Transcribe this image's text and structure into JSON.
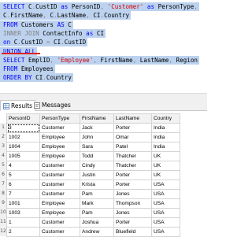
{
  "editor": {
    "lines": [
      {
        "parts": [
          {
            "t": "SELECT ",
            "c": "kw"
          },
          {
            "t": "C",
            "c": "id"
          },
          {
            "t": ".",
            "c": "gray"
          },
          {
            "t": "CustID ",
            "c": "id"
          },
          {
            "t": "as ",
            "c": "kw"
          },
          {
            "t": "PersonID",
            "c": "id"
          },
          {
            "t": ", ",
            "c": "gray"
          },
          {
            "t": "'Customer'",
            "c": "str"
          },
          {
            "t": " as ",
            "c": "kw"
          },
          {
            "t": "PersonType",
            "c": "id"
          },
          {
            "t": ",",
            "c": "gray"
          }
        ]
      },
      {
        "parts": [
          {
            "t": "C",
            "c": "id"
          },
          {
            "t": ".",
            "c": "gray"
          },
          {
            "t": "FirstName",
            "c": "id"
          },
          {
            "t": ", ",
            "c": "gray"
          },
          {
            "t": "C",
            "c": "id"
          },
          {
            "t": ".",
            "c": "gray"
          },
          {
            "t": "LastName",
            "c": "id"
          },
          {
            "t": ", ",
            "c": "gray"
          },
          {
            "t": "CI",
            "c": "id"
          },
          {
            "t": ".",
            "c": "gray"
          },
          {
            "t": "Country",
            "c": "id"
          }
        ]
      },
      {
        "parts": [
          {
            "t": "FROM ",
            "c": "kw"
          },
          {
            "t": "Customers ",
            "c": "id"
          },
          {
            "t": "AS ",
            "c": "kw"
          },
          {
            "t": "C",
            "c": "id"
          }
        ]
      },
      {
        "parts": [
          {
            "t": "INNER JOIN ",
            "c": "gray"
          },
          {
            "t": "ContactInfo ",
            "c": "id"
          },
          {
            "t": "as ",
            "c": "kw"
          },
          {
            "t": "CI",
            "c": "id"
          }
        ]
      },
      {
        "parts": [
          {
            "t": "on ",
            "c": "kw"
          },
          {
            "t": "C",
            "c": "id"
          },
          {
            "t": ".",
            "c": "gray"
          },
          {
            "t": "CustID ",
            "c": "id"
          },
          {
            "t": "= ",
            "c": "gray"
          },
          {
            "t": "CI",
            "c": "id"
          },
          {
            "t": ".",
            "c": "gray"
          },
          {
            "t": "CustID",
            "c": "id"
          }
        ]
      },
      {
        "parts": [
          {
            "t": "UNION ALL",
            "c": "kw"
          }
        ]
      },
      {
        "parts": [
          {
            "t": "SELECT ",
            "c": "kw"
          },
          {
            "t": "EmplID",
            "c": "id"
          },
          {
            "t": ", ",
            "c": "gray"
          },
          {
            "t": "'Employee'",
            "c": "str"
          },
          {
            "t": ", ",
            "c": "gray"
          },
          {
            "t": "FirstName",
            "c": "id"
          },
          {
            "t": ", ",
            "c": "gray"
          },
          {
            "t": "LastName",
            "c": "id"
          },
          {
            "t": ", ",
            "c": "gray"
          },
          {
            "t": "Region",
            "c": "id"
          }
        ]
      },
      {
        "parts": [
          {
            "t": "FROM ",
            "c": "kw"
          },
          {
            "t": "Employees",
            "c": "id"
          }
        ]
      },
      {
        "parts": [
          {
            "t": "ORDER BY ",
            "c": "kw"
          },
          {
            "t": "CI",
            "c": "id"
          },
          {
            "t": ".",
            "c": "gray"
          },
          {
            "t": "Country",
            "c": "id"
          }
        ]
      }
    ]
  },
  "tabs": {
    "results": "Results",
    "messages": "Messages"
  },
  "results": {
    "columns": [
      "PersonID",
      "PersonType",
      "FirstName",
      "LastName",
      "Country"
    ],
    "rows": [
      [
        "3",
        "Customer",
        "Jack",
        "Porter",
        "India"
      ],
      [
        "1002",
        "Employee",
        "John",
        "Omar",
        "India"
      ],
      [
        "1004",
        "Employee",
        "Sara",
        "Patel",
        "India"
      ],
      [
        "1005",
        "Employee",
        "Todd",
        "Thatcher",
        "UK"
      ],
      [
        "4",
        "Customer",
        "Cindy",
        "Thatcher",
        "UK"
      ],
      [
        "5",
        "Customer",
        "Justin",
        "Porter",
        "UK"
      ],
      [
        "6",
        "Customer",
        "Krista",
        "Porter",
        "USA"
      ],
      [
        "7",
        "Customer",
        "Pam",
        "Jones",
        "USA"
      ],
      [
        "1001",
        "Employee",
        "Mark",
        "Thompson",
        "USA"
      ],
      [
        "1003",
        "Employee",
        "Pam",
        "Jones",
        "USA"
      ],
      [
        "1",
        "Customer",
        "Joshua",
        "Porter",
        "USA"
      ],
      [
        "2",
        "Customer",
        "Andrew",
        "Bluefield",
        "USA"
      ]
    ],
    "row_numbers": [
      "1",
      "2",
      "3",
      "4",
      "5",
      "6",
      "7",
      "8",
      "9",
      "10",
      "11",
      "12"
    ]
  }
}
